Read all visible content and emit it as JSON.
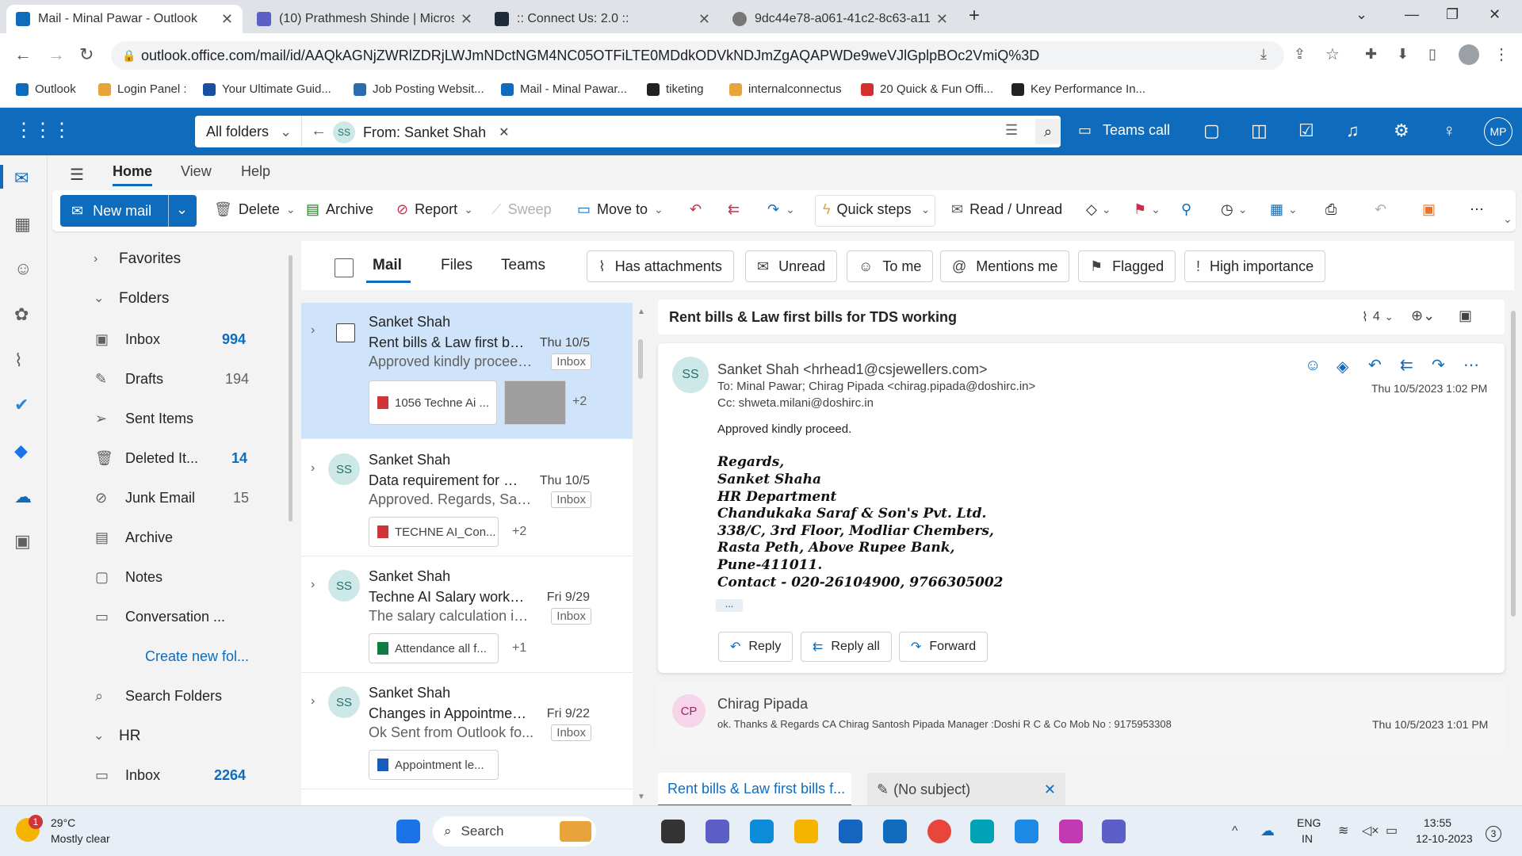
{
  "browser": {
    "tabs": [
      {
        "title": "Mail - Minal Pawar - Outlook",
        "active": true
      },
      {
        "title": "(10) Prathmesh Shinde | Microso"
      },
      {
        "title": ":: Connect Us: 2.0 ::"
      },
      {
        "title": "9dc44e78-a061-41c2-8c63-a11b"
      }
    ],
    "url": "outlook.office.com/mail/id/AAQkAGNjZWRlZDRjLWJmNDctNGM4NC05OTFiLTE0MDdkODVkNDJmZgAQAPWDe9weVJlGplpBOc2VmiQ%3D",
    "bookmarks": [
      "Outlook",
      "Login Panel :",
      "Your Ultimate Guid...",
      "Job Posting Websit...",
      "Mail - Minal Pawar...",
      "tiketing",
      "internalconnectus",
      "20 Quick & Fun Offi...",
      "Key Performance In..."
    ]
  },
  "header": {
    "scope": "All folders",
    "search_chip_initials": "SS",
    "search_chip": "From: Sanket Shah",
    "teams_call": "Teams call",
    "user_initials": "MP"
  },
  "ribbon": {
    "tabs": [
      "Home",
      "View",
      "Help"
    ],
    "new_mail": "New mail",
    "delete": "Delete",
    "archive": "Archive",
    "report": "Report",
    "sweep": "Sweep",
    "move_to": "Move to",
    "quick_steps": "Quick steps",
    "read_unread": "Read / Unread"
  },
  "folders": {
    "favorites": "Favorites",
    "folders_label": "Folders",
    "items": [
      {
        "label": "Inbox",
        "count": "994"
      },
      {
        "label": "Drafts",
        "count": "194"
      },
      {
        "label": "Sent Items",
        "count": ""
      },
      {
        "label": "Deleted It...",
        "count": "14"
      },
      {
        "label": "Junk Email",
        "count": "15"
      },
      {
        "label": "Archive",
        "count": ""
      },
      {
        "label": "Notes",
        "count": ""
      },
      {
        "label": "Conversation ...",
        "count": ""
      }
    ],
    "create_new": "Create new fol...",
    "search_folders": "Search Folders",
    "hr": "HR",
    "hr_inbox": "Inbox",
    "hr_inbox_count": "2264"
  },
  "list": {
    "tabs": [
      "Mail",
      "Files",
      "Teams"
    ],
    "filters": [
      "Has attachments",
      "Unread",
      "To me",
      "Mentions me",
      "Flagged",
      "High importance"
    ],
    "messages": [
      {
        "initials": "SS",
        "sender": "Sanket Shah",
        "subject": "Rent bills & Law first bill...",
        "date": "Thu 10/5",
        "preview": "Approved kindly proceed...",
        "folder": "Inbox",
        "attachment": "1056 Techne Ai ...",
        "more": "+2"
      },
      {
        "initials": "SS",
        "sender": "Sanket Shah",
        "subject": "Data requirement for Se...",
        "date": "Thu 10/5",
        "preview": "Approved. Regards, Sank...",
        "folder": "Inbox",
        "attachment": "TECHNE AI_Con...",
        "more": "+2"
      },
      {
        "initials": "SS",
        "sender": "Sanket Shah",
        "subject": "Techne AI Salary working...",
        "date": "Fri 9/29",
        "preview": "The salary calculation is c...",
        "folder": "Inbox",
        "attachment": "Attendance all f...",
        "more": "+1"
      },
      {
        "initials": "SS",
        "sender": "Sanket Shah",
        "subject": "Changes in Appointment...",
        "date": "Fri 9/22",
        "preview": "Ok Sent from Outlook fo...",
        "folder": "Inbox",
        "attachment": "Appointment le...",
        "more": ""
      }
    ]
  },
  "reading": {
    "subject": "Rent bills & Law first bills for TDS working",
    "attach_count": "4",
    "from_initials": "SS",
    "from": "Sanket Shah <hrhead1@csjewellers.com>",
    "to": "To:  Minal Pawar;  Chirag Pipada <chirag.pipada@doshirc.in>",
    "cc": "Cc:  shweta.milani@doshirc.in",
    "datetime": "Thu 10/5/2023 1:02 PM",
    "body": "Approved kindly proceed.",
    "signature": [
      "Regards,",
      "Sanket Shaha",
      "HR Department",
      "Chandukaka Saraf & Son's Pvt. Ltd.",
      "338/C, 3rd Floor, Modliar Chembers,",
      "Rasta Peth, Above Rupee Bank,",
      "Pune-411011.",
      "Contact - 020-26104900, 9766305002"
    ],
    "ellipsis": "...",
    "reply": "Reply",
    "reply_all": "Reply all",
    "forward": "Forward",
    "second": {
      "initials": "CP",
      "sender": "Chirag Pipada",
      "preview": "ok. Thanks & Regards CA Chirag Santosh Pipada Manager :Doshi R C & Co Mob No : 9175953308",
      "datetime": "Thu 10/5/2023 1:01 PM"
    },
    "bottom_tabs": [
      "Rent bills & Law first bills f...",
      "(No subject)"
    ]
  },
  "taskbar": {
    "temp": "29°C",
    "weather": "Mostly clear",
    "weather_badge": "1",
    "search": "Search",
    "lang1": "ENG",
    "lang2": "IN",
    "time": "13:55",
    "date": "12-10-2023",
    "notif": "3"
  }
}
